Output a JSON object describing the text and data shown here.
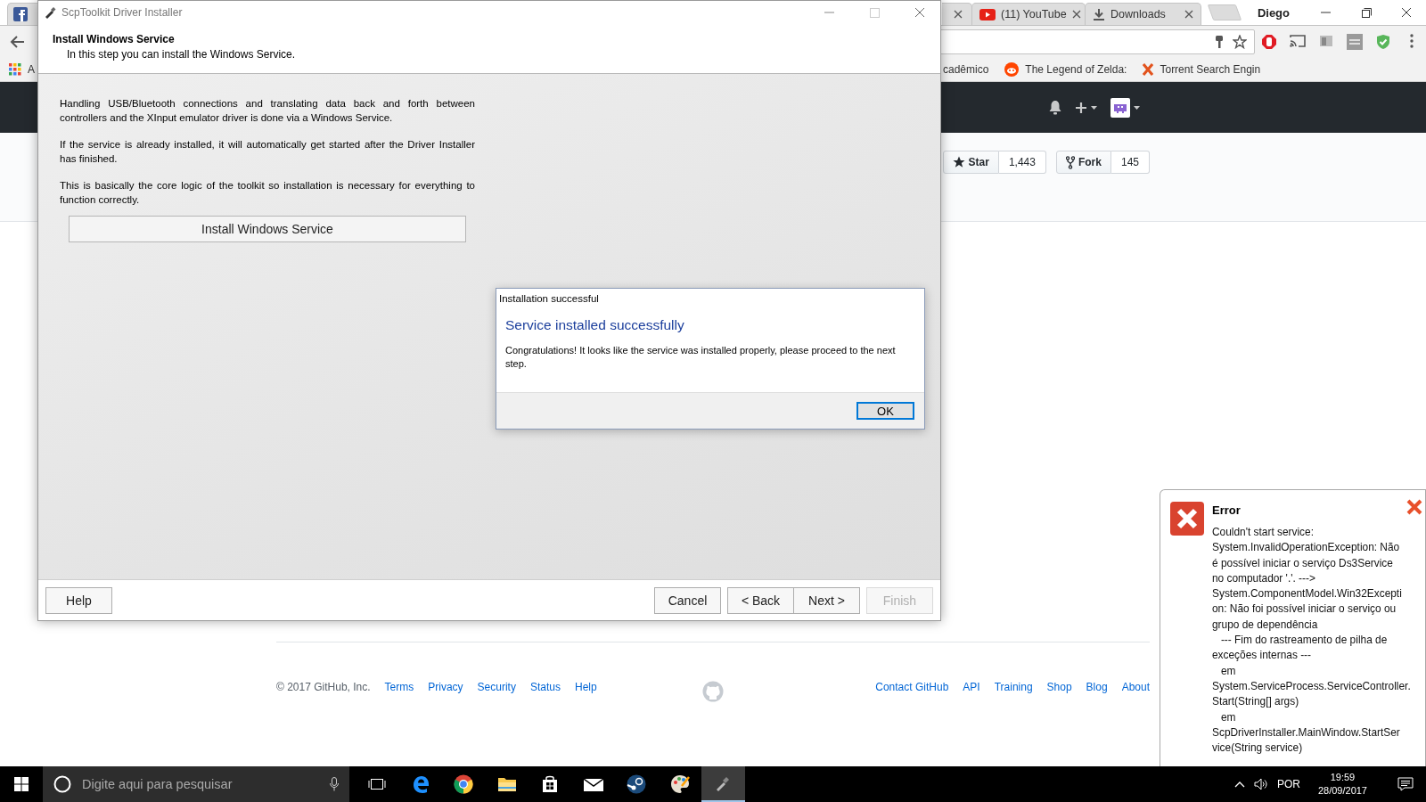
{
  "browser": {
    "tabs": [
      {
        "kind": "social",
        "selected": false
      },
      {
        "kind": "covered",
        "selected": false
      },
      {
        "kind": "video",
        "title": "(11) YouTube",
        "selected": false
      },
      {
        "kind": "download",
        "title": "Downloads",
        "selected": false
      }
    ],
    "profile": "Diego",
    "bookmarks": [
      {
        "label": "A",
        "kind": "apps"
      },
      {
        "label": "cadêmico",
        "kind": "plain"
      },
      {
        "label": "The Legend of Zelda:",
        "kind": "forum"
      },
      {
        "label": "Torrent Search Engin",
        "kind": "cross"
      }
    ],
    "repo_actions": [
      {
        "label": "Star",
        "count": "1,443",
        "kind": "star"
      },
      {
        "label": "Fork",
        "count": "145",
        "kind": "fork"
      }
    ],
    "footer": {
      "copyright": "© 2017 GitHub, Inc.",
      "links_left": [
        "Terms",
        "Privacy",
        "Security",
        "Status",
        "Help"
      ],
      "links_right": [
        "Contact GitHub",
        "API",
        "Training",
        "Shop",
        "Blog",
        "About"
      ]
    }
  },
  "installer": {
    "title": "ScpToolkit Driver Installer",
    "step_title": "Install Windows Service",
    "step_subtitle": "In this step you can install the Windows Service.",
    "paragraphs": [
      "Handling USB/Bluetooth connections and translating data back and forth between controllers and the XInput emulator driver is done via a Windows Service.",
      "If the service is already installed, it will automatically get started after the Driver Installer has finished.",
      "This is basically the core logic of the toolkit so installation is necessary for everything to function correctly."
    ],
    "action_button": "Install Windows Service",
    "buttons": [
      {
        "label": "Help",
        "disabled": false
      },
      {
        "label": "Cancel",
        "disabled": false
      },
      {
        "label": "< Back",
        "disabled": false
      },
      {
        "label": "Next >",
        "disabled": false
      },
      {
        "label": "Finish",
        "disabled": true
      }
    ]
  },
  "dialog": {
    "title": "Installation successful",
    "heading": "Service installed successfully",
    "message": "Congratulations! It looks like the service was installed properly, please proceed to the next step.",
    "button": {
      "label": "OK",
      "focused": true
    }
  },
  "error_toast": {
    "title": "Error",
    "message": "Couldn't start service:\nSystem.InvalidOperationException: Não\né possível iniciar o serviço Ds3Service\nno computador '.'. --->\nSystem.ComponentModel.Win32Excepti\non: Não foi possível iniciar o serviço ou\ngrupo de dependência\n   --- Fim do rastreamento de pilha de\nexceções internas ---\n   em\nSystem.ServiceProcess.ServiceController.\nStart(String[] args)\n   em\nScpDriverInstaller.MainWindow.StartSer\nvice(String service)"
  },
  "taskbar": {
    "search_placeholder": "Digite aqui para pesquisar",
    "apps": [
      {
        "kind": "taskview",
        "selected": false
      },
      {
        "kind": "edge",
        "selected": false
      },
      {
        "kind": "chrome",
        "selected": false
      },
      {
        "kind": "folder",
        "selected": false
      },
      {
        "kind": "store",
        "selected": false
      },
      {
        "kind": "mail",
        "selected": false
      },
      {
        "kind": "steam",
        "selected": false
      },
      {
        "kind": "paint",
        "selected": false
      },
      {
        "kind": "tool",
        "selected": true
      }
    ],
    "language": "POR",
    "time": "19:59",
    "date": "28/09/2017"
  }
}
